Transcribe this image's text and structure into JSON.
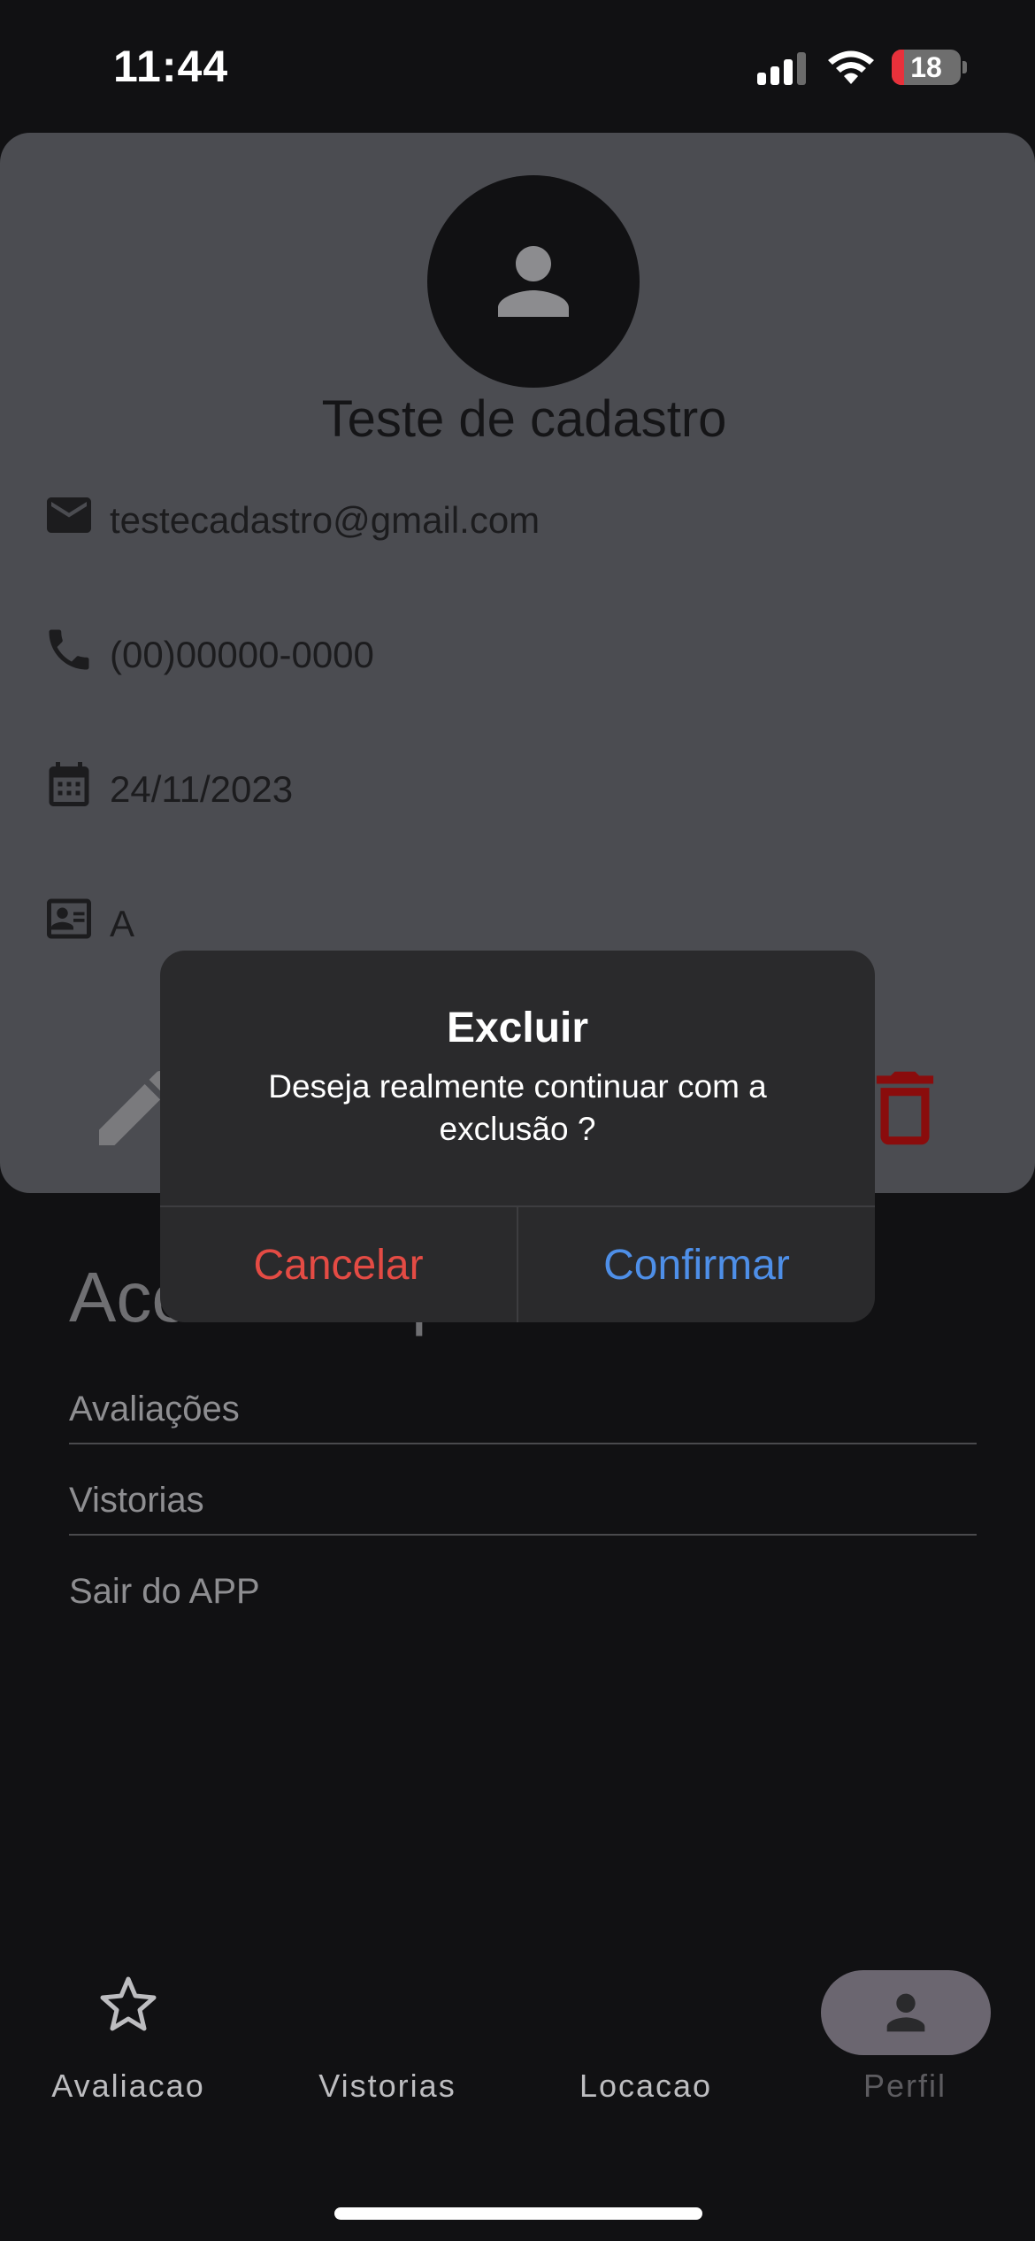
{
  "status_bar": {
    "time": "11:44",
    "battery_level": "18",
    "battery_fraction": 0.18
  },
  "profile": {
    "name": "Teste de cadastro",
    "email": "testecadastro@gmail.com",
    "phone": "(00)00000-0000",
    "date": "24/11/2023",
    "document": "A"
  },
  "quick_access": {
    "title": "Acesso Rápido",
    "items": [
      {
        "label": "Avaliações"
      },
      {
        "label": "Vistorias"
      },
      {
        "label": "Sair do APP"
      }
    ]
  },
  "dialog": {
    "title": "Excluir",
    "message": "Deseja realmente continuar com a exclusão ?",
    "cancel_label": "Cancelar",
    "confirm_label": "Confirmar"
  },
  "bottom_nav": {
    "items": [
      {
        "label": "Avaliacao",
        "icon": "star-icon"
      },
      {
        "label": "Vistorias",
        "icon": "clipboard-icon"
      },
      {
        "label": "Locacao",
        "icon": "key-icon"
      },
      {
        "label": "Perfil",
        "icon": "person-icon",
        "active": true
      }
    ]
  },
  "colors": {
    "background": "#111113",
    "card": "#4b4c51",
    "dialog": "#2a2a2c",
    "destructive": "#e44b44",
    "accent": "#4e8fe8",
    "delete_icon": "#8a0c0c"
  }
}
